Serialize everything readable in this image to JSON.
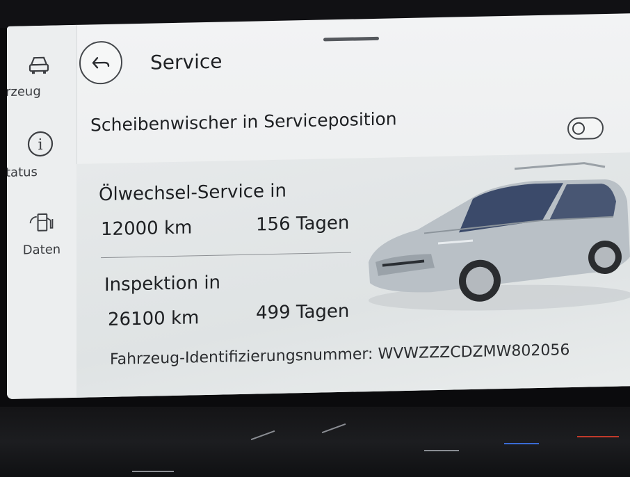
{
  "sidebar": {
    "items": [
      {
        "label": "rzeug",
        "icon": "car-icon"
      },
      {
        "label": "tatus",
        "icon": "info-icon"
      },
      {
        "label": "Daten",
        "icon": "fuel-pump-icon"
      }
    ]
  },
  "header": {
    "title": "Service",
    "back_icon": "back-arrow-icon"
  },
  "wiper": {
    "label": "Scheibenwischer in Serviceposition",
    "toggle_on": false
  },
  "oil_service": {
    "label": "Ölwechsel-Service in",
    "distance": "12000 km",
    "days": "156 Tagen"
  },
  "inspection": {
    "label": "Inspektion in",
    "distance": "26100 km",
    "days": "499 Tagen"
  },
  "vin": {
    "text": "Fahrzeug-Identifizierungsnummer: WVWZZZCDZMW802056"
  },
  "colors": {
    "screen_bg": "#eceeef",
    "text": "#1e2023",
    "car_body": "#b9c0c6"
  }
}
